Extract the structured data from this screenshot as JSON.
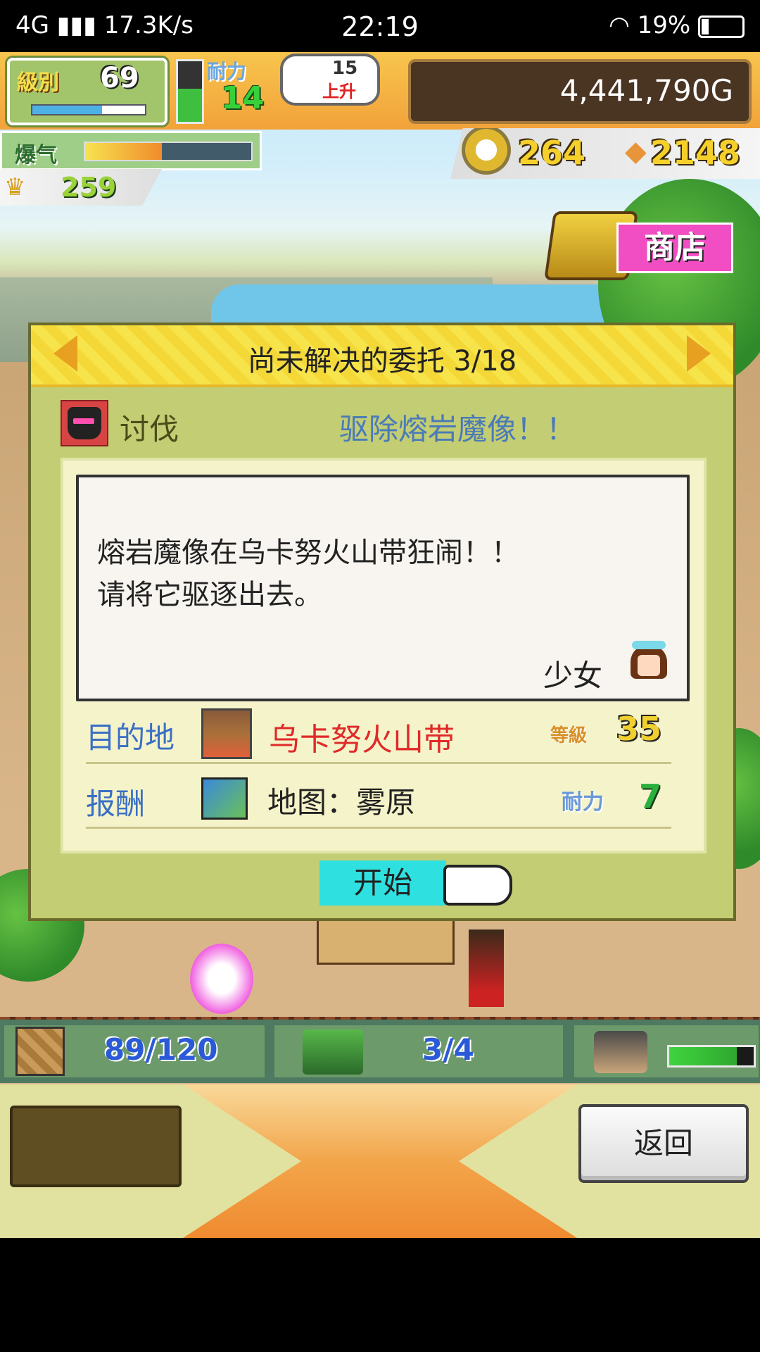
{
  "status_bar": {
    "network": "4G",
    "speed": "17.3K/s",
    "time": "22:19",
    "battery": "19%"
  },
  "hud": {
    "level_label": "級別",
    "level_value": "69",
    "stamina_label": "耐力",
    "stamina_value": "14",
    "bubble_number": "15",
    "bubble_text": "上升",
    "gold": "4,441,790G",
    "boom_label": "爆气",
    "fans_value": "259",
    "medals": "264",
    "wood": "2148",
    "shop_label": "商店"
  },
  "dialog": {
    "title": "尚未解决的委托 3/18",
    "quest_type": "讨伐",
    "quest_name": "驱除熔岩魔像！！",
    "message_line1": "熔岩魔像在乌卡努火山带狂闹！！",
    "message_line2": "请将它驱逐出去。",
    "sender": "少女",
    "destination_label": "目的地",
    "destination": "乌卡努火山带",
    "level_label": "等級",
    "level_value": "35",
    "reward_label": "报酬",
    "reward": "地图：雾原",
    "stamina_label": "耐力",
    "stamina_value": "7",
    "start_label": "开始"
  },
  "bottom_hud": {
    "capacity": "89/120",
    "teams": "3/4"
  },
  "actions": {
    "back_label": "返回"
  },
  "colors": {
    "dialog_bg": "#c3cd73",
    "title_bar": "#f7e34a",
    "start_button": "#2fe0e0",
    "destination_text": "#e02a2a",
    "label_text": "#3a6fc6"
  },
  "icons": [
    "signal-icon",
    "wifi-icon",
    "battery-icon",
    "medal-icon",
    "wood-icon",
    "treasure-chest-icon",
    "arrow-left-icon",
    "arrow-right-icon",
    "demon-icon",
    "girl-portrait-icon",
    "volcano-icon",
    "map-icon",
    "pointer-hand-icon",
    "crate-icon",
    "team-icon",
    "dog-icon"
  ]
}
